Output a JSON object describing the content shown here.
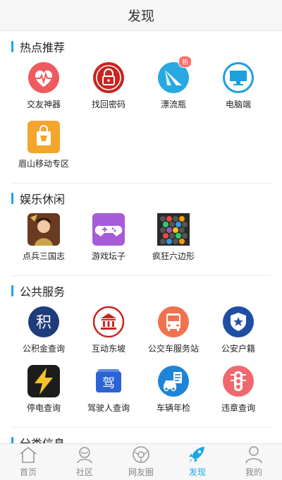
{
  "header": {
    "title": "发现"
  },
  "sections": [
    {
      "title": "热点推荐",
      "items": [
        {
          "label": "交友神器",
          "icon": "heart-pulse-icon",
          "badge": ""
        },
        {
          "label": "找回密码",
          "icon": "lock-icon",
          "badge": ""
        },
        {
          "label": "漂流瓶",
          "icon": "paper-plane-icon",
          "badge": "热"
        },
        {
          "label": "电脑端",
          "icon": "monitor-icon",
          "badge": ""
        },
        {
          "label": "眉山移动专区",
          "icon": "shopping-bag-icon",
          "badge": ""
        }
      ]
    },
    {
      "title": "娱乐休闲",
      "items": [
        {
          "label": "点兵三国志",
          "icon": "game-character-icon"
        },
        {
          "label": "游戏坛子",
          "icon": "gamepad-icon"
        },
        {
          "label": "疯狂六边形",
          "icon": "hexagon-puzzle-icon"
        }
      ]
    },
    {
      "title": "公共服务",
      "items": [
        {
          "label": "公积金查询",
          "icon": "fund-icon",
          "glyph": "积"
        },
        {
          "label": "互动东坡",
          "icon": "government-building-icon"
        },
        {
          "label": "公交车服务站",
          "icon": "bus-icon"
        },
        {
          "label": "公安户籍",
          "icon": "police-badge-icon"
        },
        {
          "label": "停电查询",
          "icon": "lightning-icon"
        },
        {
          "label": "驾驶人查询",
          "icon": "driver-license-icon",
          "glyph": "驾"
        },
        {
          "label": "车辆年检",
          "icon": "car-inspection-icon"
        },
        {
          "label": "违章查询",
          "icon": "traffic-light-icon"
        }
      ]
    },
    {
      "title": "分类信息"
    }
  ],
  "tabbar": [
    {
      "label": "首页",
      "icon": "home-icon",
      "active": false
    },
    {
      "label": "社区",
      "icon": "community-icon",
      "active": false
    },
    {
      "label": "网友圈",
      "icon": "friends-circle-icon",
      "active": false
    },
    {
      "label": "发现",
      "icon": "rocket-icon",
      "active": true
    },
    {
      "label": "我的",
      "icon": "user-icon",
      "active": false
    }
  ],
  "colors": {
    "accent": "#1aa6e8",
    "hot_badge": "#ff6b6b"
  }
}
